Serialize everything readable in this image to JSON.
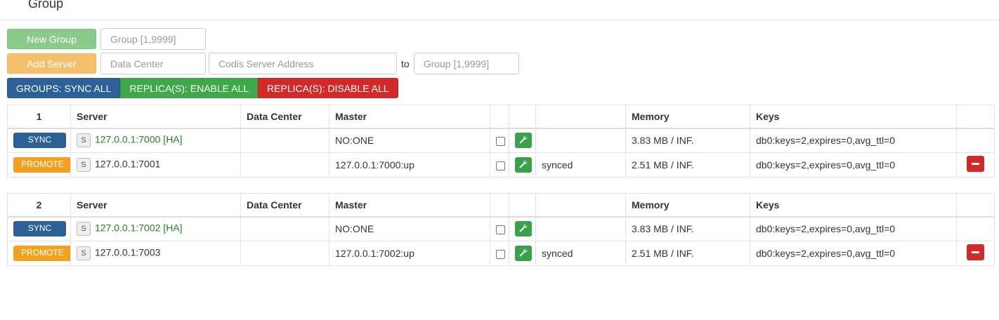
{
  "header": {
    "title": "Group"
  },
  "controls": {
    "new_group_label": "New Group",
    "new_group_placeholder": "Group [1,9999]",
    "add_server_label": "Add Server",
    "data_center_placeholder": "Data Center",
    "server_address_placeholder": "Codis Server Address",
    "to_label": "to",
    "target_group_placeholder": "Group [1,9999]"
  },
  "bulk_actions": {
    "sync_all": "GROUPS: SYNC ALL",
    "enable_all": "REPLICA(S): ENABLE ALL",
    "disable_all": "REPLICA(S): DISABLE ALL"
  },
  "columns": {
    "server": "Server",
    "data_center": "Data Center",
    "master": "Master",
    "memory": "Memory",
    "keys": "Keys"
  },
  "groups": [
    {
      "id": "1",
      "servers": [
        {
          "action": "SYNC",
          "badge": "S",
          "address": "127.0.0.1:7000 [HA]",
          "data_center": "",
          "master": "NO:ONE",
          "status": "",
          "memory": "3.83 MB / INF.",
          "keys": "db0:keys=2,expires=0,avg_ttl=0"
        },
        {
          "action": "PROMOTE",
          "badge": "S",
          "address": "127.0.0.1:7001",
          "data_center": "",
          "master": "127.0.0.1:7000:up",
          "status": "synced",
          "memory": "2.51 MB / INF.",
          "keys": "db0:keys=2,expires=0,avg_ttl=0"
        }
      ]
    },
    {
      "id": "2",
      "servers": [
        {
          "action": "SYNC",
          "badge": "S",
          "address": "127.0.0.1:7002 [HA]",
          "data_center": "",
          "master": "NO:ONE",
          "status": "",
          "memory": "3.83 MB / INF.",
          "keys": "db0:keys=2,expires=0,avg_ttl=0"
        },
        {
          "action": "PROMOTE",
          "badge": "S",
          "address": "127.0.0.1:7003",
          "data_center": "",
          "master": "127.0.0.1:7002:up",
          "status": "synced",
          "memory": "2.51 MB / INF.",
          "keys": "db0:keys=2,expires=0,avg_ttl=0"
        }
      ]
    }
  ],
  "colors": {
    "sync_blue": "#2d6097",
    "promote_orange": "#f0a11f",
    "enable_green": "#3fa84a",
    "disable_red": "#d22a2a"
  },
  "icons": {
    "wrench": "wrench-icon",
    "remove": "minus-icon"
  }
}
